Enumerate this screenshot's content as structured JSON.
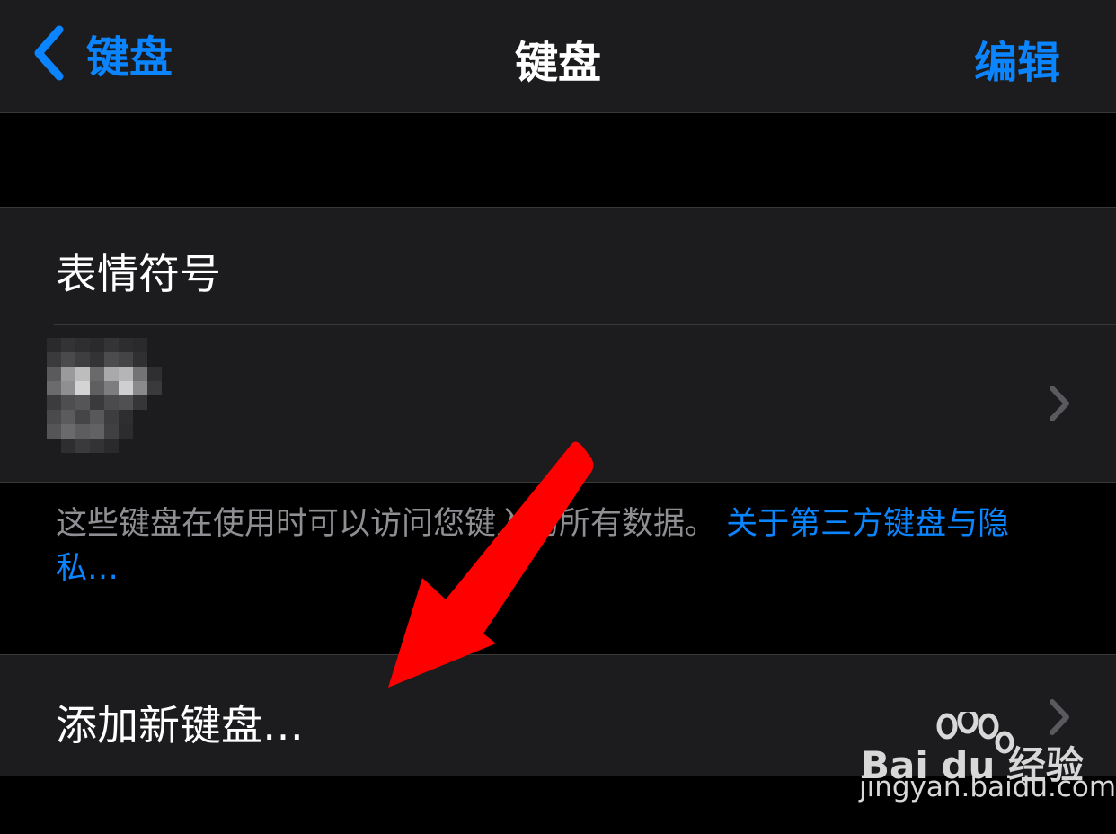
{
  "navbar": {
    "back_label": "键盘",
    "title": "键盘",
    "edit_label": "编辑"
  },
  "keyboards": {
    "items": [
      {
        "label": "表情符号"
      },
      {
        "label": ""
      }
    ]
  },
  "footer": {
    "note_text": "这些键盘在使用时可以访问您键入的所有数据。",
    "link_text": "关于第三方键盘与隐私…"
  },
  "add_keyboard": {
    "label": "添加新键盘…"
  },
  "watermark": {
    "brand": "Bai du 经验",
    "url": "jingyan.baidu.com"
  },
  "colors": {
    "accent": "#0a84ff",
    "background": "#000000",
    "cell": "#1c1c1e",
    "separator": "#38383a",
    "secondary_text": "#8e8e93",
    "annotation_arrow": "#ff0000"
  }
}
